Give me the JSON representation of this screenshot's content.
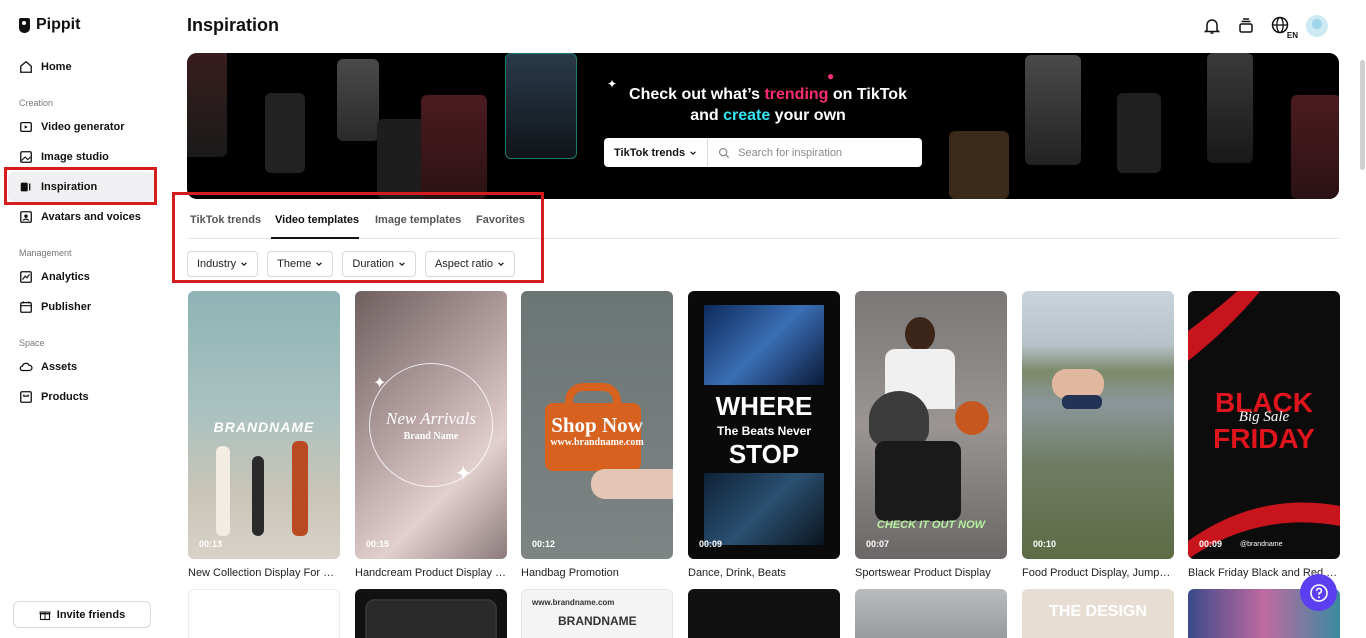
{
  "app": {
    "name": "Pippit"
  },
  "sidebar": {
    "home": "Home",
    "creation_header": "Creation",
    "video_generator": "Video generator",
    "image_studio": "Image studio",
    "inspiration": "Inspiration",
    "avatars": "Avatars and voices",
    "management_header": "Management",
    "analytics": "Analytics",
    "publisher": "Publisher",
    "space_header": "Space",
    "assets": "Assets",
    "products": "Products",
    "invite": "Invite friends"
  },
  "header": {
    "title": "Inspiration",
    "language": "EN"
  },
  "banner": {
    "line1_a": "Check out what’s ",
    "line1_b": "trending",
    "line1_c": " on TikTok",
    "line2_a": "and ",
    "line2_b": "create",
    "line2_c": " your own",
    "select_label": "TikTok trends",
    "search_placeholder": "Search for inspiration"
  },
  "tabs": [
    "TikTok trends",
    "Video templates",
    "Image templates",
    "Favorites"
  ],
  "filters": [
    "Industry",
    "Theme",
    "Duration",
    "Aspect ratio"
  ],
  "cards": [
    {
      "title": "New Collection Display For Bl...",
      "duration": "00:13",
      "overlay": "BRANDNAME"
    },
    {
      "title": "Handcream Product Display C...",
      "duration": "00:15",
      "overlay": "New Arrivals",
      "overlay2": "Brand Name"
    },
    {
      "title": "Handbag Promotion",
      "duration": "00:12",
      "overlay": "Shop Now",
      "overlay2": "www.brandname.com"
    },
    {
      "title": "Dance, Drink, Beats",
      "duration": "00:09",
      "overlay": "WHERE",
      "overlay2": "The Beats Never",
      "overlay3": "STOP"
    },
    {
      "title": "Sportswear Product Display",
      "duration": "00:07",
      "overlay": "CHECK IT OUT NOW"
    },
    {
      "title": "Food Product Display, Jumps...",
      "duration": "00:10"
    },
    {
      "title": "Black Friday Black and Red B...",
      "duration": "00:09",
      "overlay": "BLACK",
      "overlay2": "Big Sale",
      "overlay3": "FRIDAY",
      "overlay4": "@brandname"
    }
  ],
  "row2": {
    "card3_url": "www.brandname.com",
    "card3_brand": "BRANDNAME",
    "card6_text": "THE DESIGN"
  },
  "colors": {
    "accent_pink": "#ff2d6f",
    "accent_cyan": "#36e3f2",
    "highlight_red": "#d41e1e",
    "help_purple": "#5b3ff0"
  }
}
